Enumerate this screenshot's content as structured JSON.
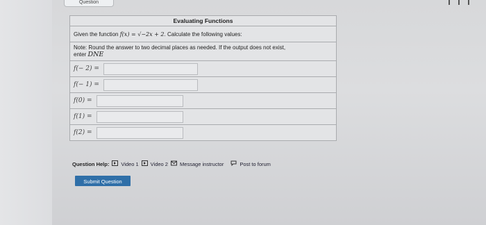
{
  "window": {
    "tab_label": "Question"
  },
  "question": {
    "title": "Evaluating Functions",
    "given_prefix": "Given the function",
    "function_lhs": "f(x) = ",
    "function_rhs": "√−2x + 2",
    "given_suffix": ". Calculate the following values:",
    "note_line1": "Note: Round the answer to two decimal places as needed. If the output does not exist,",
    "note_line2_prefix": "enter",
    "note_line2_dne": "DNE",
    "rows": [
      {
        "label": "f(− 2) =",
        "value": "",
        "input_width_frac": 0.36
      },
      {
        "label": "f(− 1) =",
        "value": "",
        "input_width_frac": 0.36
      },
      {
        "label": "f(0) =",
        "value": "",
        "input_width_frac": 0.33
      },
      {
        "label": "f(1) =",
        "value": "",
        "input_width_frac": 0.33
      },
      {
        "label": "f(2) =",
        "value": "",
        "input_width_frac": 0.33
      }
    ]
  },
  "help": {
    "label": "Question Help:",
    "video1": "Video 1",
    "video2": "Video 2",
    "message": "Message instructor",
    "forum": "Post to forum",
    "icons": [
      "video-icon",
      "video-icon",
      "mail-icon",
      "forum-icon"
    ]
  },
  "submit_label": "Submit Question",
  "colors": {
    "submit_bg": "#2f6fa8",
    "border": "#a9abae",
    "background": "#e3e4e6"
  }
}
